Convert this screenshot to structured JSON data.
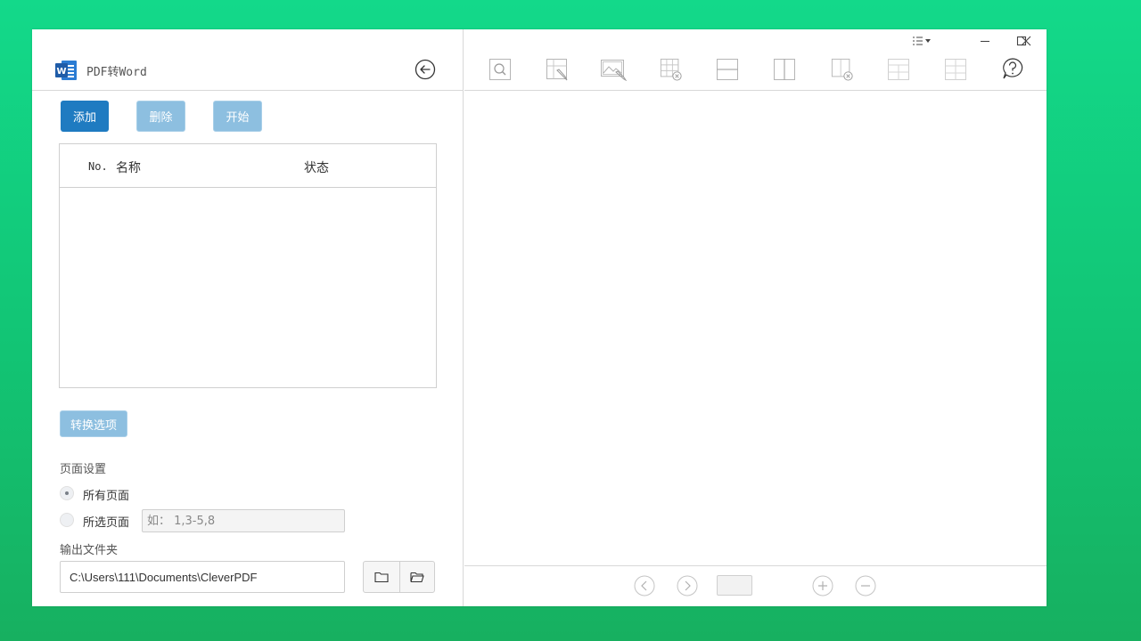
{
  "app": {
    "title": "PDF转Word",
    "logo_icon": "word-icon",
    "back_icon": "arrow-left-circle-icon"
  },
  "actions": {
    "add_label": "添加",
    "delete_label": "删除",
    "start_label": "开始"
  },
  "file_table": {
    "columns": [
      "No.",
      "名称",
      "状态"
    ],
    "rows": []
  },
  "convert_options_label": "转换选项",
  "page_settings": {
    "title": "页面设置",
    "options": [
      {
        "label": "所有页面",
        "checked": true
      },
      {
        "label": "所选页面",
        "checked": false
      }
    ],
    "range_placeholder": "如： 1,3-5,8"
  },
  "output": {
    "title": "输出文件夹",
    "path": "C:\\Users\\111\\Documents\\CleverPDF",
    "browse_icon": "folder-icon",
    "open_icon": "folder-open-icon"
  },
  "toolbar": {
    "tools": [
      "zoom-icon",
      "edit-table-icon",
      "edit-image-icon",
      "delete-table-icon",
      "split-horizontal-icon",
      "split-vertical-icon",
      "delete-column-icon",
      "merge-rows-icon",
      "merge-cells-icon",
      "help-icon"
    ]
  },
  "window_controls": [
    "menu-icon",
    "minimize-icon",
    "maximize-icon",
    "close-icon"
  ],
  "pager": {
    "current_page": "",
    "controls": [
      "prev-page-icon",
      "next-page-icon",
      "zoom-in-icon",
      "zoom-out-icon"
    ]
  },
  "colors": {
    "primary": "#1f7bc1",
    "disabled": "#8dbfe0",
    "background_top": "#13d98a",
    "background_bottom": "#17b060"
  }
}
